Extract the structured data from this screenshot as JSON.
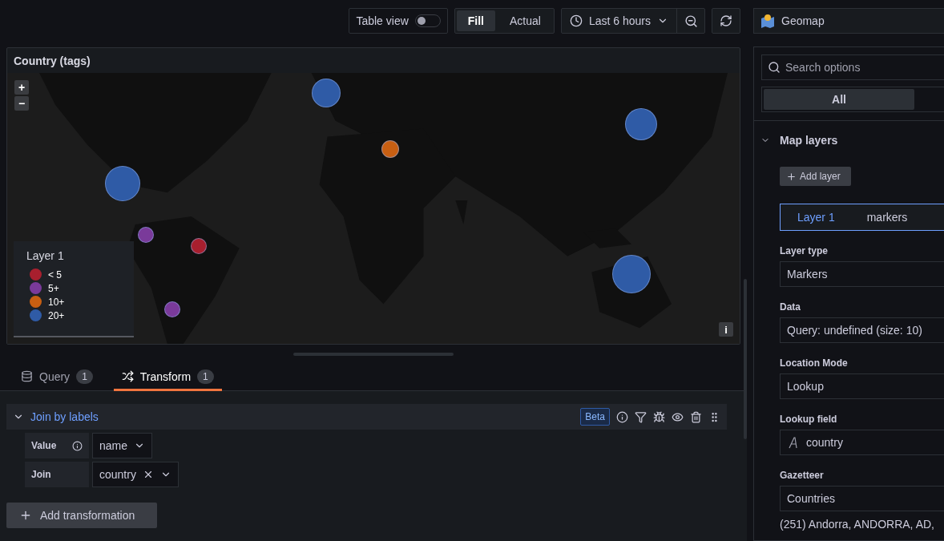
{
  "toolbar": {
    "table_view": {
      "label": "Table view",
      "on": false
    },
    "fit_options": [
      {
        "label": "Fill",
        "selected": true
      },
      {
        "label": "Actual",
        "selected": false
      }
    ],
    "time_range": "Last 6 hours"
  },
  "panel": {
    "title": "Country (tags)",
    "zoom_in": "+",
    "zoom_out": "−",
    "info": "i",
    "markers": [
      {
        "color": "#2f5ba6"
      },
      {
        "color": "#2f5ba6"
      },
      {
        "color": "#c85f12"
      },
      {
        "color": "#2f5ba6"
      },
      {
        "color": "#7a3a9a"
      },
      {
        "color": "#a81f2e"
      },
      {
        "color": "#7a3a9a"
      },
      {
        "color": "#2f5ba6"
      }
    ],
    "legend": {
      "title": "Layer 1",
      "items": [
        {
          "label": "< 5",
          "color": "#a81f2e"
        },
        {
          "label": "5+",
          "color": "#7a3a9a"
        },
        {
          "label": "10+",
          "color": "#c85f12"
        },
        {
          "label": "20+",
          "color": "#2f5ba6"
        }
      ]
    }
  },
  "tabs": [
    {
      "label": "Query",
      "count": "1",
      "selected": false
    },
    {
      "label": "Transform",
      "count": "1",
      "selected": true
    }
  ],
  "transformation": {
    "title": "Join by labels",
    "expanded": true,
    "badge": "Beta",
    "fields": [
      {
        "label": "Value",
        "value": "name",
        "info": true,
        "clearable": false
      },
      {
        "label": "Join",
        "value": "country",
        "info": false,
        "clearable": true
      }
    ]
  },
  "add_transformation": "Add transformation",
  "options": {
    "visualization": "Geomap",
    "search_placeholder": "Search options",
    "filters": [
      {
        "label": "All",
        "selected": true
      }
    ],
    "section": {
      "title": "Map layers",
      "expanded": true,
      "add_layer": "Add layer",
      "layer": {
        "name": "Layer 1",
        "type": "markers",
        "selected": true
      },
      "fields": [
        {
          "label": "Layer type",
          "value": "Markers",
          "kind": "select"
        },
        {
          "label": "Data",
          "value": "Query: undefined (size: 10)",
          "kind": "select"
        },
        {
          "label": "Location Mode",
          "value": "Lookup",
          "kind": "select"
        },
        {
          "label": "Lookup field",
          "value": "country",
          "kind": "fieldref"
        },
        {
          "label": "Gazetteer",
          "value": "Countries",
          "kind": "select"
        }
      ],
      "gazetteer_note": "(251) Andorra, ANDORRA, AD,"
    }
  }
}
